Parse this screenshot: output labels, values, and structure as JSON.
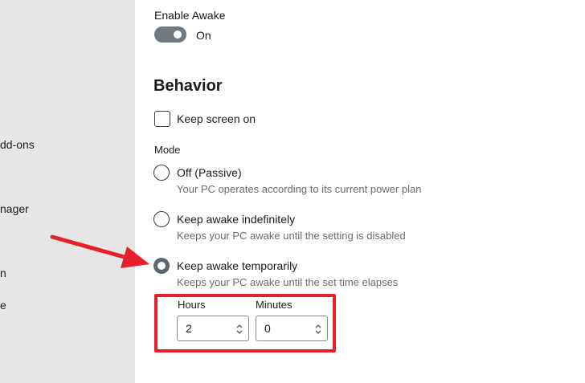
{
  "sidebar": {
    "items": [
      {
        "label": "dd-ons"
      },
      {
        "label": "nager"
      },
      {
        "label": "n"
      },
      {
        "label": "e"
      }
    ]
  },
  "awake": {
    "enable_label": "Enable Awake",
    "toggle_state": "On"
  },
  "behavior": {
    "title": "Behavior",
    "keep_screen_on_label": "Keep screen on",
    "mode_label": "Mode",
    "options": [
      {
        "label": "Off (Passive)",
        "hint": "Your PC operates according to its current power plan",
        "selected": false
      },
      {
        "label": "Keep awake indefinitely",
        "hint": "Keeps your PC awake until the setting is disabled",
        "selected": false
      },
      {
        "label": "Keep awake temporarily",
        "hint": "Keeps your PC awake until the set time elapses",
        "selected": true
      }
    ],
    "hours": {
      "label": "Hours",
      "value": "2"
    },
    "minutes": {
      "label": "Minutes",
      "value": "0"
    }
  },
  "annotation_color": "#e8202a"
}
